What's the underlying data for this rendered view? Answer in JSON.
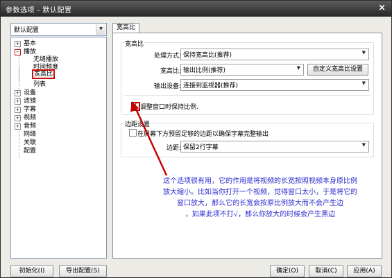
{
  "window": {
    "title": "参数选项 - 默认配置",
    "close_glyph": "×"
  },
  "profile_select": {
    "value": "默认配置"
  },
  "tree": {
    "items": [
      {
        "label": "基本",
        "toggle": "+"
      },
      {
        "label": "播放",
        "toggle": "−"
      },
      {
        "label": "无缝播放"
      },
      {
        "label": "时间频度"
      },
      {
        "label": "宽高比"
      },
      {
        "label": "列表"
      },
      {
        "label": "设备",
        "toggle": "+"
      },
      {
        "label": "滤镜",
        "toggle": "+"
      },
      {
        "label": "字幕",
        "toggle": "+"
      },
      {
        "label": "视频",
        "toggle": "+"
      },
      {
        "label": "音频",
        "toggle": "+"
      },
      {
        "label": "网络"
      },
      {
        "label": "关联"
      },
      {
        "label": "配置"
      }
    ]
  },
  "tab": {
    "label": "宽高比"
  },
  "aspect_group": {
    "title": "宽高比",
    "mode_label": "处理方式:",
    "mode_value": "保持宽高比(推荐)",
    "ratio_label": "宽高比:",
    "ratio_value": "输出比例(推荐)",
    "custom_button": "自定义宽高比设置",
    "device_label": "输出设备:",
    "device_value": "连接到监视器(推荐)",
    "keep_ratio_checkbox": "调整窗口时保持比例."
  },
  "margin_group": {
    "title": "边距设置",
    "reserve_checkbox": "在屏幕下方预留足够的边距以确保字幕完整输出",
    "margin_label": "边距:",
    "margin_value": "保留2行字幕"
  },
  "annotation": {
    "lines": [
      "这个选项很有用，它的作用是将视频的长宽按照视频本身原比例",
      "放大缩小。比如当你打开一个视频，觉得窗口太小，于是将它的",
      "窗口放大，那么它的长宽会按原比例放大而不会产生边",
      "，如果此项不打√，那么你放大的时候会产生黑边"
    ],
    "arrow_color": "#c80000",
    "text_color": "#2b2bd0"
  },
  "buttons": {
    "init": "初始化(I)",
    "export": "导出配置(S)",
    "ok": "确定(O)",
    "cancel": "取消(C)",
    "apply": "应用(A)"
  }
}
